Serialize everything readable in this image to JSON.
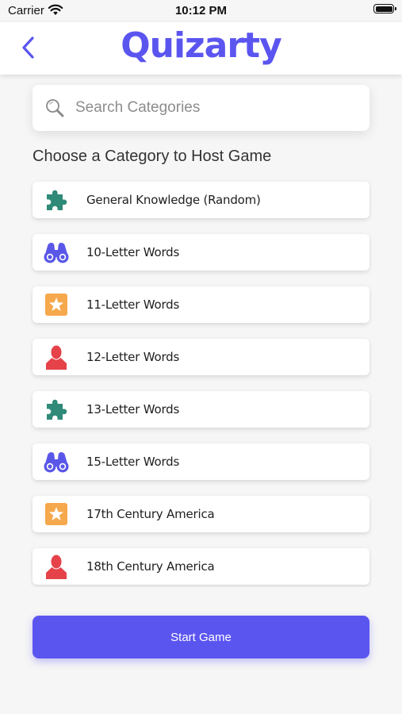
{
  "status_bar": {
    "carrier": "Carrier",
    "time": "10:12 PM"
  },
  "header": {
    "logo_text": "Quizarty",
    "back_icon": "chevron-left-icon"
  },
  "search": {
    "placeholder": "Search Categories",
    "value": ""
  },
  "section_title": "Choose a Category to Host Game",
  "categories": [
    {
      "label": "General Knowledge (Random)",
      "icon": "puzzle-icon"
    },
    {
      "label": "10-Letter Words",
      "icon": "binoculars-icon"
    },
    {
      "label": "11-Letter Words",
      "icon": "star-icon"
    },
    {
      "label": "12-Letter Words",
      "icon": "person-icon"
    },
    {
      "label": "13-Letter Words",
      "icon": "puzzle-icon"
    },
    {
      "label": "15-Letter Words",
      "icon": "binoculars-icon"
    },
    {
      "label": "17th Century America",
      "icon": "star-icon"
    },
    {
      "label": "18th Century America",
      "icon": "person-icon"
    }
  ],
  "start_button": {
    "label": "Start Game"
  },
  "colors": {
    "accent": "#5b55f0",
    "teal": "#2f8a78",
    "orange": "#f6a84c",
    "red": "#e5424a",
    "blue": "#5a57e8"
  }
}
